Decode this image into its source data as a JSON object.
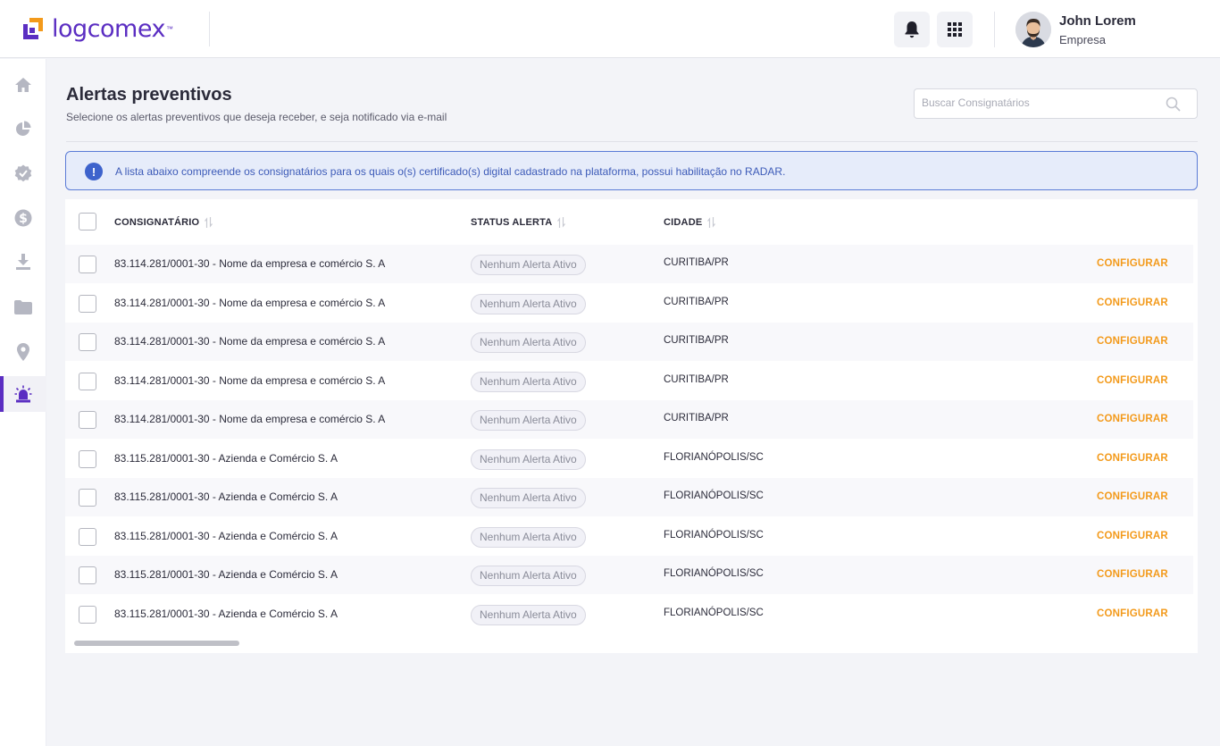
{
  "header": {
    "logo_text": "logcomex",
    "logo_tm": "™",
    "user_name": "John Lorem",
    "user_company": "Empresa",
    "icons": {
      "notifications": "bell-icon",
      "apps": "grid-icon",
      "avatar": "user-avatar"
    }
  },
  "sidebar": {
    "items": [
      {
        "icon": "home-icon",
        "active": false
      },
      {
        "icon": "pie-chart-icon",
        "active": false
      },
      {
        "icon": "verified-badge-icon",
        "active": false
      },
      {
        "icon": "dollar-icon",
        "active": false
      },
      {
        "icon": "download-icon",
        "active": false
      },
      {
        "icon": "folder-icon",
        "active": false
      },
      {
        "icon": "location-pin-icon",
        "active": false
      },
      {
        "icon": "siren-icon",
        "active": true
      }
    ]
  },
  "page": {
    "title": "Alertas preventivos",
    "subtitle": "Selecione os alertas preventivos que deseja receber, e seja notificado via e-mail"
  },
  "search": {
    "placeholder": "Buscar Consignatários"
  },
  "banner": {
    "icon": "!",
    "text": "A lista abaixo compreende os consignatários para os quais o(s) certificado(s) digital cadastrado na plataforma, possui habilitação no RADAR."
  },
  "table": {
    "columns": [
      "CONSIGNATÁRIO",
      "STATUS ALERTA",
      "CIDADE"
    ],
    "rows": [
      {
        "name": "83.114.281/0001-30 - Nome da empresa e comércio S. A",
        "status": "Nenhum Alerta Ativo",
        "city": "CURITIBA/PR",
        "action": "CONFIGURAR"
      },
      {
        "name": "83.114.281/0001-30 - Nome da empresa e comércio S. A",
        "status": "Nenhum Alerta Ativo",
        "city": "CURITIBA/PR",
        "action": "CONFIGURAR"
      },
      {
        "name": "83.114.281/0001-30 - Nome da empresa e comércio S. A",
        "status": "Nenhum Alerta Ativo",
        "city": "CURITIBA/PR",
        "action": "CONFIGURAR"
      },
      {
        "name": "83.114.281/0001-30 - Nome da empresa e comércio S. A",
        "status": "Nenhum Alerta Ativo",
        "city": "CURITIBA/PR",
        "action": "CONFIGURAR"
      },
      {
        "name": "83.114.281/0001-30 - Nome da empresa e comércio S. A",
        "status": "Nenhum Alerta Ativo",
        "city": "CURITIBA/PR",
        "action": "CONFIGURAR"
      },
      {
        "name": "83.115.281/0001-30 - Azienda e Comércio S. A",
        "status": "Nenhum Alerta Ativo",
        "city": "FLORIANÓPOLIS/SC",
        "action": "CONFIGURAR"
      },
      {
        "name": "83.115.281/0001-30 - Azienda e Comércio S. A",
        "status": "Nenhum Alerta Ativo",
        "city": "FLORIANÓPOLIS/SC",
        "action": "CONFIGURAR"
      },
      {
        "name": "83.115.281/0001-30 - Azienda e Comércio S. A",
        "status": "Nenhum Alerta Ativo",
        "city": "FLORIANÓPOLIS/SC",
        "action": "CONFIGURAR"
      },
      {
        "name": "83.115.281/0001-30 - Azienda e Comércio S. A",
        "status": "Nenhum Alerta Ativo",
        "city": "FLORIANÓPOLIS/SC",
        "action": "CONFIGURAR"
      },
      {
        "name": "83.115.281/0001-30 - Azienda e Comércio S. A",
        "status": "Nenhum Alerta Ativo",
        "city": "FLORIANÓPOLIS/SC",
        "action": "CONFIGURAR"
      }
    ]
  },
  "colors": {
    "brand": "#5b2ec2",
    "action": "#f39a1b",
    "info": "#3e63cc",
    "info_bg": "#e6ecfa"
  }
}
